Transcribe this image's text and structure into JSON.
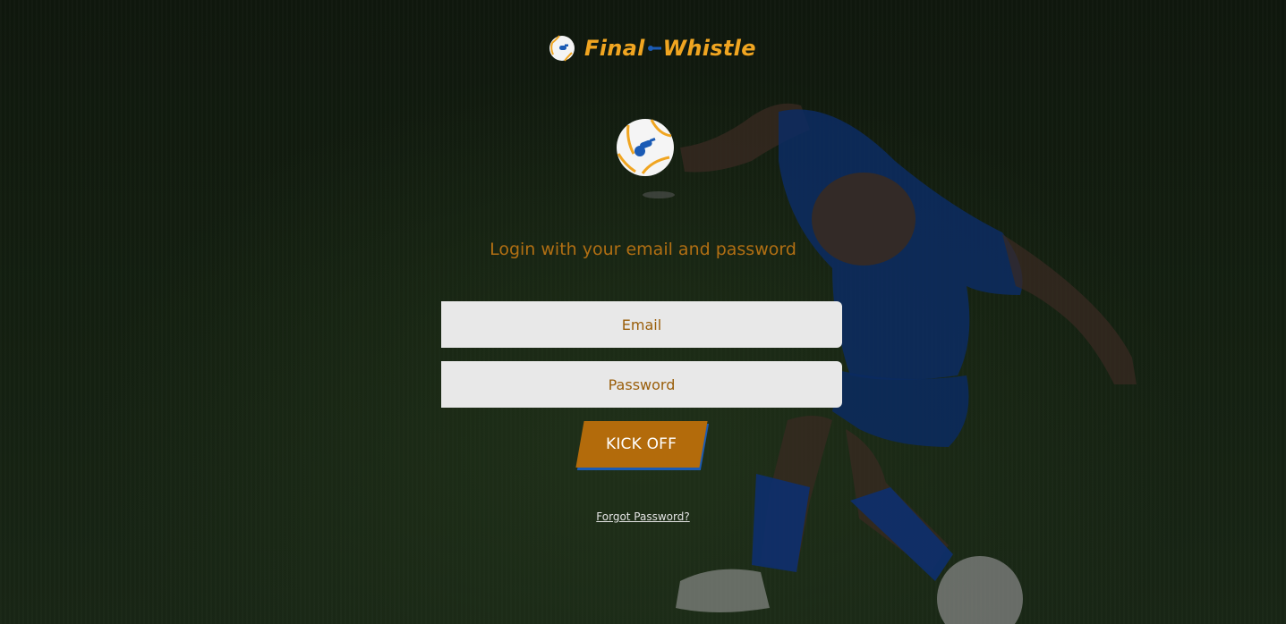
{
  "brand": {
    "name_part1": "Final",
    "name_part2": "Whistle",
    "primary_color": "#f0a521",
    "accent_color": "#1b5bb5"
  },
  "login": {
    "subtitle": "Login with your email and password",
    "email_placeholder": "Email",
    "password_placeholder": "Password",
    "submit_label": "KICK OFF",
    "forgot_label": "Forgot Password?"
  },
  "icons": {
    "logo": "soccer-ball-whistle-icon",
    "hero": "soccer-ball-whistle-icon"
  }
}
